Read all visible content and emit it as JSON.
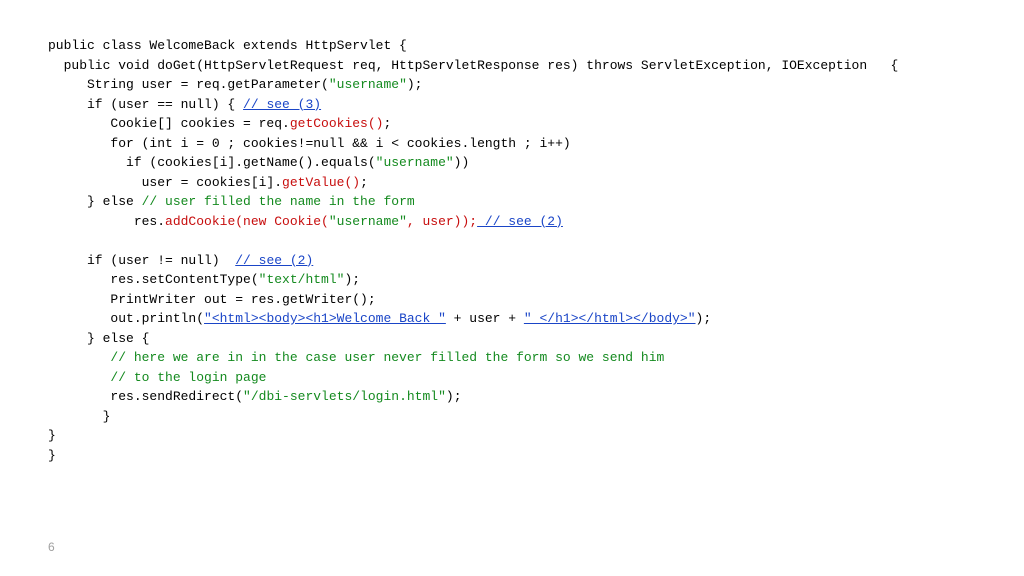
{
  "page_number": "6",
  "code": {
    "l01a": "public class WelcomeBack extends HttpServlet {",
    "l02a": "  public void doGet(HttpServletRequest req, HttpServletResponse res) throws ServletException, IOException   {",
    "l03a": "     String user = req.getParameter(",
    "l03b": "\"username\"",
    "l03c": ");",
    "l04a": "     if (user == null) { ",
    "l04b": "// see (3)",
    "l05a": "        Cookie[] cookies = req.",
    "l05b": "getCookies()",
    "l05c": ";",
    "l06a": "        for (int i = 0 ; cookies!=null && i < cookies.length ; i++)",
    "l07a": "          if (cookies[i].getName().equals(",
    "l07b": "\"username\"",
    "l07c": "))",
    "l08a": "            user = cookies[i].",
    "l08b": "getValue()",
    "l08c": ";",
    "l09a": "     } else ",
    "l09b": "// user filled the name in the form",
    "l10a": "           res.",
    "l10b": "addCookie(new Cookie(",
    "l10c": "\"username\"",
    "l10d": ", user));",
    "l10e": " // see (2)",
    "l11a": "",
    "l12a": "     if (user != null)  ",
    "l12b": "// see (2)",
    "l13a": "        res.setContentType(",
    "l13b": "\"text/html\"",
    "l13c": ");",
    "l14a": "        PrintWriter out = res.getWriter();",
    "l15a": "        out.println(",
    "l15b": "\"<html><body><h1>Welcome Back \"",
    "l15c": " + user + ",
    "l15d": "\" </h1></html></body>\"",
    "l15e": ");",
    "l16a": "     } else {",
    "l17a": "        // here we are in in the case user never filled the form so we send him",
    "l18a": "        // to the login page",
    "l19a": "        res.sendRedirect(",
    "l19b": "\"/dbi-servlets/login.html\"",
    "l19c": ");",
    "l20a": "       }",
    "l21a": "}",
    "l22a": "}"
  }
}
